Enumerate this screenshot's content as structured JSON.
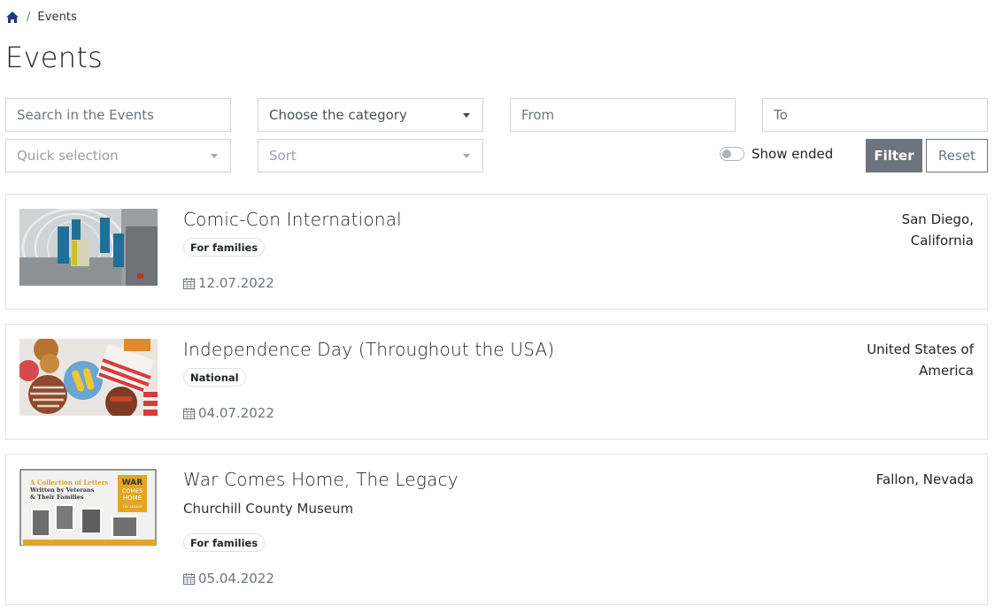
{
  "breadcrumb": {
    "home_icon": "home-icon",
    "separator": "/",
    "current": "Events"
  },
  "page": {
    "title": "Events"
  },
  "filters": {
    "search_placeholder": "Search in the Events",
    "category": {
      "selected": "Choose the category",
      "icon": "caret-down-icon"
    },
    "from_placeholder": "From",
    "to_placeholder": "To",
    "quick_selection": {
      "selected": "Quick selection",
      "icon": "caret-down-icon"
    },
    "sort": {
      "selected": "Sort",
      "icon": "caret-down-icon"
    },
    "show_ended": {
      "label": "Show ended",
      "checked": false
    },
    "filter_button": "Filter",
    "reset_button": "Reset"
  },
  "colors": {
    "primary_dark": "#1e3a7b",
    "secondary_button": "#6c757d",
    "border": "#ced4da"
  },
  "events": [
    {
      "title": "Comic-Con International",
      "subtitle": "",
      "badge": "For families",
      "date": "12.07.2022",
      "date_icon": "calendar-icon",
      "location_line1": "San Diego,",
      "location_line2": "California",
      "image": "comic-con-hallway-banners"
    },
    {
      "title": "Independence Day (Throughout the USA)",
      "subtitle": "",
      "badge": "National",
      "date": "04.07.2022",
      "date_icon": "calendar-icon",
      "location_line1": "United States of",
      "location_line2": "America",
      "image": "independence-day-food-table"
    },
    {
      "title": "War Comes Home, The Legacy",
      "subtitle": "Churchill County Museum",
      "badge": "For families",
      "date": "05.04.2022",
      "date_icon": "calendar-icon",
      "location_line1": "Fallon, Nevada",
      "location_line2": "",
      "image": "war-comes-home-poster",
      "poster": {
        "line1": "A Collection of Letters",
        "line2": "Written by Veterans",
        "line3": "& Their Families",
        "box_title1": "WAR",
        "box_title2": "COMES",
        "box_title3": "HOME",
        "box_sub": "THE LEGACY"
      }
    }
  ]
}
